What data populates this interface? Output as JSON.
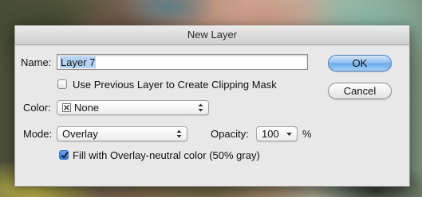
{
  "dialog": {
    "title": "New Layer",
    "name_label": "Name:",
    "name_value": "Layer 7",
    "clipping_mask_label": "Use Previous Layer to Create Clipping Mask",
    "clipping_mask_checked": false,
    "color_label": "Color:",
    "color_value": "None",
    "mode_label": "Mode:",
    "mode_value": "Overlay",
    "opacity_label": "Opacity:",
    "opacity_value": "100",
    "opacity_unit": "%",
    "fill_neutral_label": "Fill with Overlay-neutral color (50% gray)",
    "fill_neutral_checked": true,
    "ok_label": "OK",
    "cancel_label": "Cancel"
  },
  "colors": {
    "dialog_bg": "#e8e8e8",
    "default_button": "#6aa9ec",
    "selection": "#b5d3f7"
  }
}
